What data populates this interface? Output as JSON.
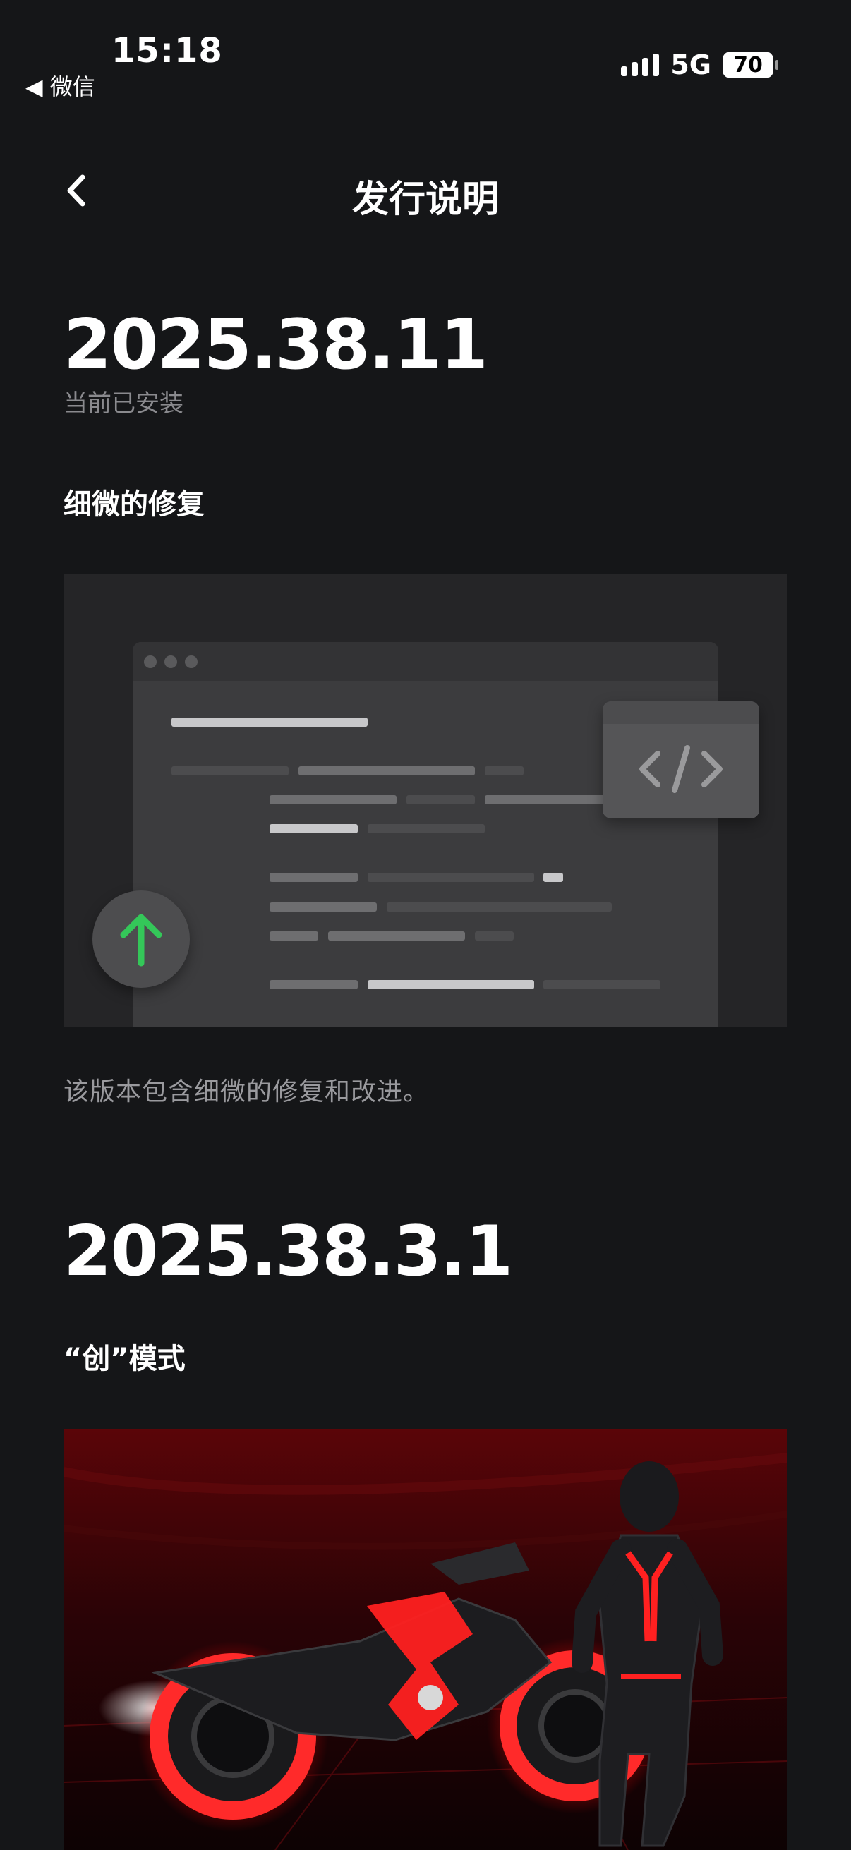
{
  "status_bar": {
    "time": "15:18",
    "back_app": "◀ 微信",
    "network": "5G",
    "battery": "70"
  },
  "nav": {
    "title": "发行说明",
    "back_icon": "chevron-left-icon"
  },
  "releases": [
    {
      "version": "2025.38.11",
      "status": "当前已安装",
      "feature_title": "细微的修复",
      "description": "该版本包含细微的修复和改进。",
      "illustration_icons": [
        "code-icon",
        "arrow-up-icon"
      ]
    },
    {
      "version": "2025.38.3.1",
      "feature_title": "“创”模式"
    }
  ],
  "colors": {
    "background": "#151618",
    "secondary_text": "#8a8a8e",
    "upgrade_green": "#34c759",
    "hero_red": "#ff1a1a"
  }
}
